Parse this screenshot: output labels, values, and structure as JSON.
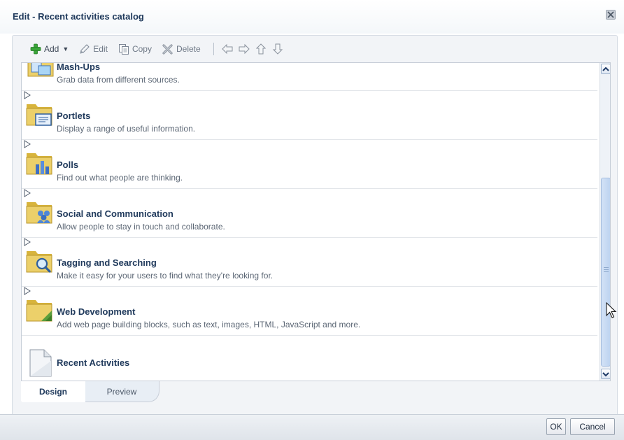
{
  "dialog": {
    "title": "Edit - Recent activities catalog"
  },
  "toolbar": {
    "add_label": "Add",
    "edit_label": "Edit",
    "copy_label": "Copy",
    "delete_label": "Delete"
  },
  "catalog": {
    "items": [
      {
        "title": "Mash-Ups",
        "description": "Grab data from different sources.",
        "icon": "folder-mashups-icon"
      },
      {
        "title": "Portlets",
        "description": "Display a range of useful information.",
        "icon": "folder-portlets-icon"
      },
      {
        "title": "Polls",
        "description": "Find out what people are thinking.",
        "icon": "folder-polls-icon"
      },
      {
        "title": "Social and Communication",
        "description": "Allow people to stay in touch and collaborate.",
        "icon": "folder-social-icon"
      },
      {
        "title": "Tagging and Searching",
        "description": "Make it easy for your users to find what they're looking for.",
        "icon": "folder-search-icon"
      },
      {
        "title": "Web Development",
        "description": "Add web page building blocks, such as text, images, HTML, JavaScript and more.",
        "icon": "folder-webdev-icon"
      },
      {
        "title": "Recent Activities",
        "description": "",
        "icon": "document-icon"
      }
    ]
  },
  "tabs": {
    "design": "Design",
    "preview": "Preview",
    "selected": "Design"
  },
  "footer": {
    "ok_label": "OK",
    "cancel_label": "Cancel"
  },
  "colors": {
    "title": "#203a5c",
    "folder": "#e3c44f",
    "add_icon": "#3aa63a",
    "scrollbar_thumb": "#bdd3f0"
  }
}
